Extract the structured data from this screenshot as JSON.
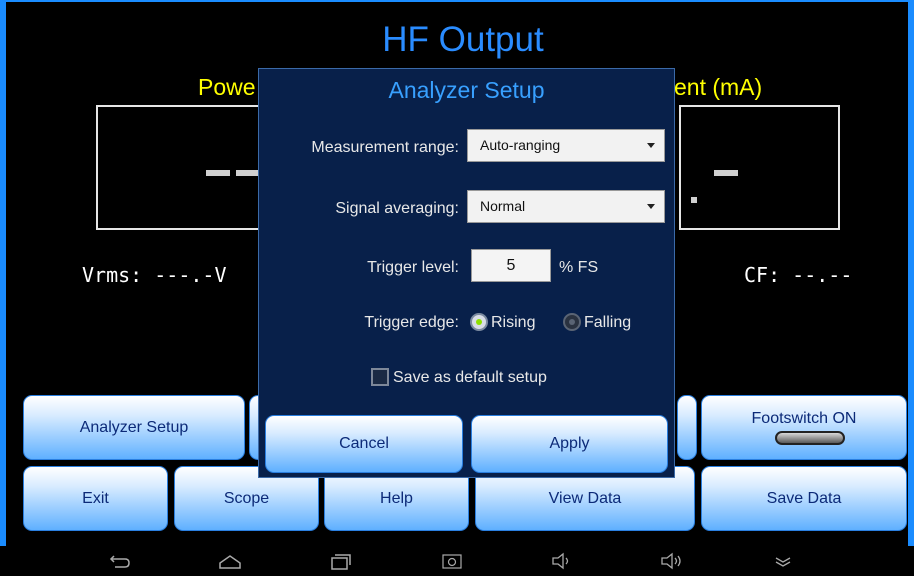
{
  "app": {
    "title": "HF Output",
    "power_label": "Powe",
    "current_label": "ent (mA)",
    "vrms_readout": "Vrms: ---.-V",
    "cf_readout": "CF: --.--"
  },
  "buttons": {
    "analyzer_setup": "Analyzer Setup",
    "footswitch": "Footswitch ON",
    "exit": "Exit",
    "scope": "Scope",
    "help": "Help",
    "view_data": "View Data",
    "save_data": "Save Data"
  },
  "dialog": {
    "title": "Analyzer Setup",
    "measurement_range_label": "Measurement range:",
    "measurement_range_value": "Auto-ranging",
    "signal_averaging_label": "Signal averaging:",
    "signal_averaging_value": "Normal",
    "trigger_level_label": "Trigger level:",
    "trigger_level_value": "5",
    "trigger_level_unit": "% FS",
    "trigger_edge_label": "Trigger edge:",
    "edge_rising": "Rising",
    "edge_falling": "Falling",
    "edge_selected": "Rising",
    "save_default_label": "Save as default setup",
    "save_default_checked": false,
    "cancel": "Cancel",
    "apply": "Apply"
  },
  "nav_icons": [
    "back-icon",
    "home-icon",
    "recents-icon",
    "screenshot-icon",
    "volume-down-icon",
    "volume-up-icon",
    "collapse-icon"
  ],
  "colors": {
    "title_blue": "#2a8cff",
    "label_yellow": "#ffff00",
    "dialog_bg": "#08204a",
    "radio_selected": "#8ee000"
  }
}
